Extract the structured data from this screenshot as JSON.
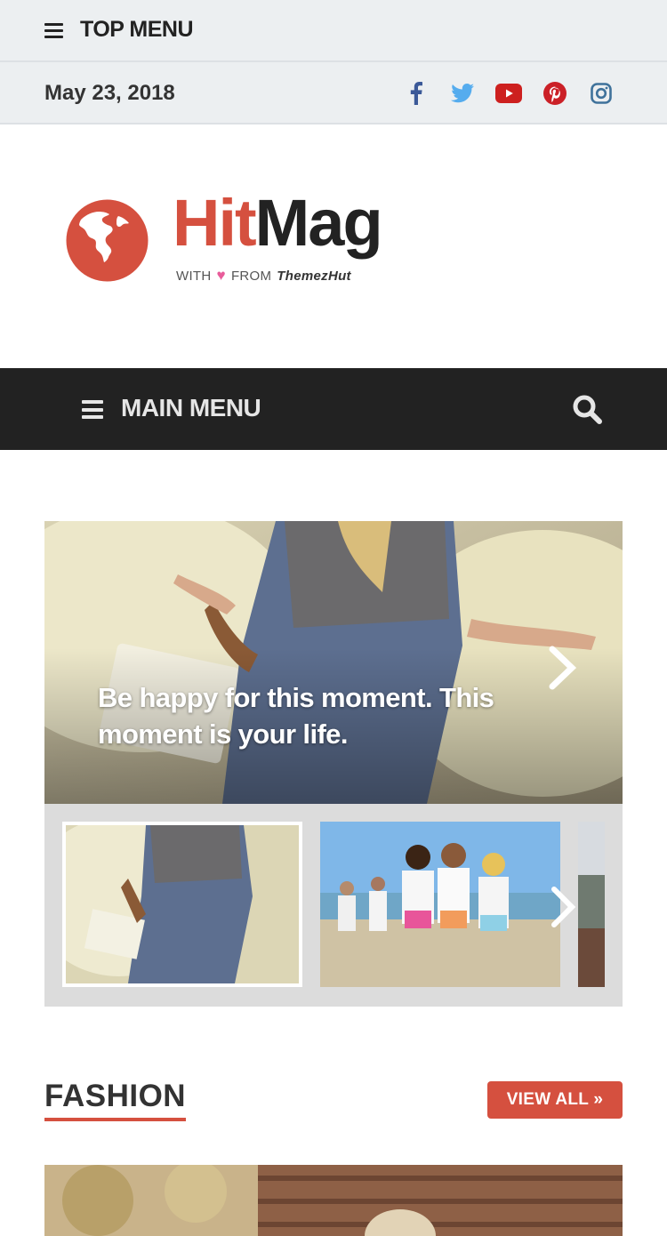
{
  "top_menu": {
    "label": "TOP MENU",
    "icon": "hamburger-icon"
  },
  "date_bar": {
    "date": "May 23, 2018",
    "social": [
      {
        "name": "facebook-icon",
        "color": "#3b5998"
      },
      {
        "name": "twitter-icon",
        "color": "#55acee"
      },
      {
        "name": "youtube-icon",
        "color": "#cd201f"
      },
      {
        "name": "pinterest-icon",
        "color": "#cb2027"
      },
      {
        "name": "instagram-icon",
        "color": "#3f729b"
      }
    ]
  },
  "logo": {
    "title_part1": "Hit",
    "title_part2": "Mag",
    "sub_with": "WITH",
    "sub_from": "FROM",
    "sub_brand": "ThemezHut",
    "accent_color": "#d5503f"
  },
  "main_menu": {
    "label": "MAIN MENU",
    "icon": "hamburger-icon",
    "search_icon": "search-icon"
  },
  "slider": {
    "caption": "Be happy for this moment. This moment is your life."
  },
  "section": {
    "title": "FASHION",
    "view_all": "VIEW ALL »"
  }
}
